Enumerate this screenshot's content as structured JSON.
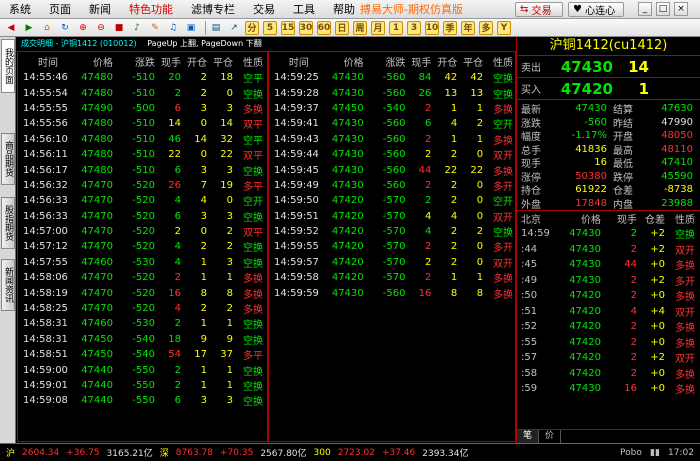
{
  "menu": {
    "items": [
      "系统",
      "页面",
      "新闻",
      "特色功能",
      "滤博专栏",
      "交易",
      "工具",
      "帮助"
    ],
    "special_index": 3,
    "app_title": "搏易大师-期权仿真版",
    "trade_button": "交易",
    "connect_button": "心连心"
  },
  "left_tabs": [
    "我的页面",
    "商品期货",
    "股指期货",
    "新闻资讯"
  ],
  "detail_header": {
    "title": "成交明细 - 沪铜1412 (010012)",
    "nav": "PageUp 上翻, PageDown 下翻"
  },
  "columns": [
    "时间",
    "价格",
    "涨跌",
    "现手",
    "开仓",
    "平仓",
    "性质"
  ],
  "left_rows": [
    [
      "14:55:46",
      "47480",
      "-510",
      "20",
      "2",
      "18",
      "空平"
    ],
    [
      "14:55:54",
      "47480",
      "-510",
      "2",
      "2",
      "0",
      "空换"
    ],
    [
      "14:55:55",
      "47490",
      "-500",
      "6",
      "3",
      "3",
      "多换"
    ],
    [
      "14:55:56",
      "47480",
      "-510",
      "14",
      "0",
      "14",
      "双平"
    ],
    [
      "14:56:10",
      "47480",
      "-510",
      "46",
      "14",
      "32",
      "空平"
    ],
    [
      "14:56:11",
      "47480",
      "-510",
      "22",
      "0",
      "22",
      "双平"
    ],
    [
      "14:56:17",
      "47480",
      "-510",
      "6",
      "3",
      "3",
      "空换"
    ],
    [
      "14:56:32",
      "47470",
      "-520",
      "26",
      "7",
      "19",
      "多平"
    ],
    [
      "14:56:33",
      "47470",
      "-520",
      "4",
      "4",
      "0",
      "空开"
    ],
    [
      "14:56:33",
      "47470",
      "-520",
      "6",
      "3",
      "3",
      "空换"
    ],
    [
      "14:57:00",
      "47470",
      "-520",
      "2",
      "0",
      "2",
      "双平"
    ],
    [
      "14:57:12",
      "47470",
      "-520",
      "4",
      "2",
      "2",
      "空换"
    ],
    [
      "14:57:55",
      "47460",
      "-530",
      "4",
      "1",
      "3",
      "空换"
    ],
    [
      "14:58:06",
      "47470",
      "-520",
      "2",
      "1",
      "1",
      "多换"
    ],
    [
      "14:58:19",
      "47470",
      "-520",
      "16",
      "8",
      "8",
      "多换"
    ],
    [
      "14:58:25",
      "47470",
      "-520",
      "4",
      "2",
      "2",
      "多换"
    ],
    [
      "14:58:31",
      "47460",
      "-530",
      "2",
      "1",
      "1",
      "空换"
    ],
    [
      "14:58:31",
      "47450",
      "-540",
      "18",
      "9",
      "9",
      "空换"
    ],
    [
      "14:58:51",
      "47450",
      "-540",
      "54",
      "17",
      "37",
      "多平"
    ],
    [
      "14:59:00",
      "47440",
      "-550",
      "2",
      "1",
      "1",
      "空换"
    ],
    [
      "14:59:01",
      "47440",
      "-550",
      "2",
      "1",
      "1",
      "空换"
    ],
    [
      "14:59:08",
      "47440",
      "-550",
      "6",
      "3",
      "3",
      "空换"
    ]
  ],
  "mid_rows": [
    [
      "14:59:25",
      "47430",
      "-560",
      "84",
      "42",
      "42",
      "空换"
    ],
    [
      "14:59:28",
      "47430",
      "-560",
      "26",
      "13",
      "13",
      "空换"
    ],
    [
      "14:59:37",
      "47450",
      "-540",
      "2",
      "1",
      "1",
      "多换"
    ],
    [
      "14:59:41",
      "47430",
      "-560",
      "6",
      "4",
      "2",
      "空开"
    ],
    [
      "14:59:43",
      "47430",
      "-560",
      "2",
      "1",
      "1",
      "多换"
    ],
    [
      "14:59:44",
      "47430",
      "-560",
      "2",
      "2",
      "0",
      "双开"
    ],
    [
      "14:59:45",
      "47430",
      "-560",
      "44",
      "22",
      "22",
      "多换"
    ],
    [
      "14:59:49",
      "47430",
      "-560",
      "2",
      "2",
      "0",
      "多开"
    ],
    [
      "14:59:50",
      "47420",
      "-570",
      "2",
      "2",
      "0",
      "空开"
    ],
    [
      "14:59:51",
      "47420",
      "-570",
      "4",
      "4",
      "0",
      "双开"
    ],
    [
      "14:59:52",
      "47420",
      "-570",
      "4",
      "2",
      "2",
      "空换"
    ],
    [
      "14:59:55",
      "47420",
      "-570",
      "2",
      "2",
      "0",
      "多开"
    ],
    [
      "14:59:57",
      "47420",
      "-570",
      "2",
      "2",
      "0",
      "双开"
    ],
    [
      "14:59:58",
      "47420",
      "-570",
      "2",
      "1",
      "1",
      "多换"
    ],
    [
      "14:59:59",
      "47430",
      "-560",
      "16",
      "8",
      "8",
      "多换"
    ]
  ],
  "quote": {
    "title": "沪铜1412(cu1412)",
    "sell_label": "卖出",
    "sell_price": "47430",
    "sell_vol": "14",
    "buy_label": "买入",
    "buy_price": "47420",
    "buy_vol": "1",
    "stats": [
      [
        "最新",
        "47430",
        "结算",
        "47630"
      ],
      [
        "涨跌",
        "-560",
        "昨结",
        "47990"
      ],
      [
        "幅度",
        "-1.17%",
        "开盘",
        "48050"
      ],
      [
        "总手",
        "41836",
        "最高",
        "48110"
      ],
      [
        "现手",
        "16",
        "最低",
        "47410"
      ],
      [
        "涨停",
        "50380",
        "跌停",
        "45590"
      ],
      [
        "持仓",
        "61922",
        "仓差",
        "-8738"
      ],
      [
        "外盘",
        "17848",
        "内盘",
        "23988"
      ]
    ]
  },
  "ticks": {
    "header": [
      "北京",
      "价格",
      "现手",
      "仓差",
      "性质"
    ],
    "rows": [
      [
        "14:59",
        "47430",
        "2",
        "+2",
        "空换"
      ],
      [
        ":44",
        "47430",
        "2",
        "+2",
        "双开"
      ],
      [
        ":45",
        "47430",
        "44",
        "+0",
        "多换"
      ],
      [
        ":49",
        "47430",
        "2",
        "+2",
        "多开"
      ],
      [
        ":50",
        "47420",
        "2",
        "+0",
        "多换"
      ],
      [
        ":51",
        "47420",
        "4",
        "+4",
        "双开"
      ],
      [
        ":52",
        "47420",
        "2",
        "+0",
        "多换"
      ],
      [
        ":55",
        "47420",
        "2",
        "+0",
        "多换"
      ],
      [
        ":57",
        "47420",
        "2",
        "+2",
        "双开"
      ],
      [
        ":58",
        "47420",
        "2",
        "+0",
        "多换"
      ],
      [
        ":59",
        "47430",
        "16",
        "+0",
        "多换"
      ]
    ],
    "tabs": [
      "笔",
      "价"
    ]
  },
  "status": {
    "sh_label": "沪",
    "sh_val": "2604.34",
    "sh_chg": "+36.75",
    "sh_amt": "3165.21亿",
    "sz_label": "深",
    "sz_val": "8763.78",
    "sz_chg": "+70.35",
    "sz_amt": "2567.80亿",
    "c300_label": "300",
    "c300_val": "2723.02",
    "c300_chg": "+37.46",
    "c300_amt": "2393.34亿",
    "brand": "Pobo",
    "clock": "17:02"
  },
  "colors": {
    "up": "#ff3030",
    "down": "#00e600",
    "accent": "#ffff00",
    "border": "#b00000"
  }
}
